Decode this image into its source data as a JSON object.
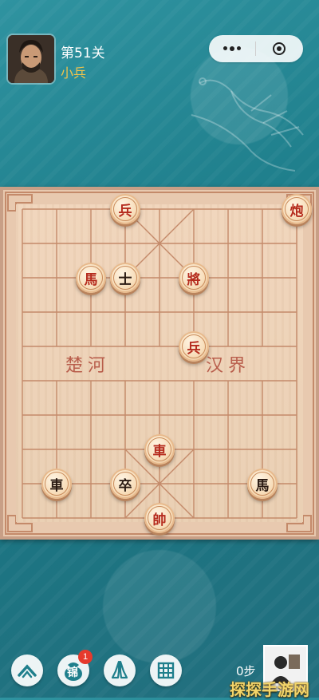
{
  "header": {
    "level_title": "第51关",
    "level_subtitle": "小兵",
    "more_icon": "more-dots-icon",
    "close_icon": "target-circle-icon"
  },
  "board": {
    "river_left": "楚河",
    "river_right": "汉界",
    "pieces": [
      {
        "label": "兵",
        "side": "red",
        "file": 3,
        "rank": 0
      },
      {
        "label": "炮",
        "side": "red",
        "file": 8,
        "rank": 0
      },
      {
        "label": "馬",
        "side": "red",
        "file": 2,
        "rank": 2
      },
      {
        "label": "士",
        "side": "black",
        "file": 3,
        "rank": 2
      },
      {
        "label": "將",
        "side": "red",
        "file": 5,
        "rank": 2
      },
      {
        "label": "兵",
        "side": "red",
        "file": 5,
        "rank": 4
      },
      {
        "label": "車",
        "side": "red",
        "file": 4,
        "rank": 7
      },
      {
        "label": "車",
        "side": "black",
        "file": 1,
        "rank": 8
      },
      {
        "label": "卒",
        "side": "black",
        "file": 3,
        "rank": 8
      },
      {
        "label": "馬",
        "side": "black",
        "file": 7,
        "rank": 8
      },
      {
        "label": "帥",
        "side": "red",
        "file": 4,
        "rank": 9
      }
    ],
    "colors": {
      "red": "#b52b1d",
      "black": "#2a1a12",
      "line": "#c48a6a"
    }
  },
  "toolbar": {
    "buttons": [
      {
        "name": "home-button",
        "icon": "chevron-up-icon"
      },
      {
        "name": "brocade-button",
        "icon": "bag-icon",
        "label": "锦",
        "badge": "1"
      },
      {
        "name": "pray-button",
        "icon": "hands-icon"
      },
      {
        "name": "grid-button",
        "icon": "grid-icon"
      }
    ],
    "steps": "0步"
  },
  "watermark": "探探手游网"
}
